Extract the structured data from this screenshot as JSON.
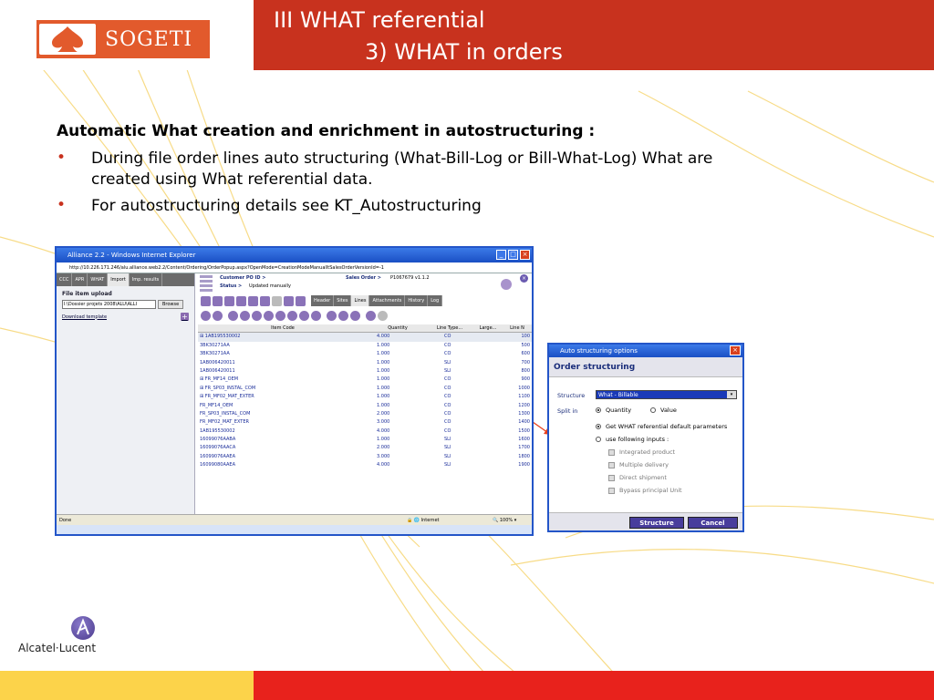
{
  "header": {
    "title_line1": "III WHAT referential",
    "title_line2": "3) WHAT in orders",
    "logo_text": "SOGETI",
    "colors": {
      "accent_red": "#c8321e",
      "logo_orange": "#e25a2c",
      "footer_yellow": "#fcd34a"
    }
  },
  "content": {
    "heading": "Automatic What creation and enrichment in autostructuring :",
    "bullets": [
      {
        "line1": "During file order lines auto structuring (What-Bill-Log or Bill-What-Log) What are",
        "line2": "created using What referential data."
      },
      {
        "line1": "For autostructuring details see KT_Autostructuring"
      }
    ]
  },
  "browser": {
    "title": "Alliance 2.2 - Windows Internet Explorer",
    "address": "http://10.226.171.246/alu.alliance.web2.2/Content/Ordering/OrderPopup.aspx?OpenMode=CreationModeManualItSalesOrderVersionId=-1",
    "left_tabs": [
      "CCC",
      "APR",
      "WHAT",
      "Import",
      "Imp. results"
    ],
    "file_upload_label": "File item upload",
    "file_path": "I:\\Dossier projets 2008\\ALU\\ALLI",
    "browse_label": "Browse",
    "download_template": "Download template",
    "customer_po_label": "Customer PO ID >",
    "status_label": "Status >",
    "status_value": "Updated manually",
    "sales_order_label": "Sales Order >",
    "sales_order_value": "P1067679  v1.1.2",
    "right_tabs": [
      "Header",
      "Sites",
      "Lines",
      "Attachments",
      "History",
      "Log"
    ],
    "grid_headers": [
      "Item Code",
      "Quantity",
      "Line Type...",
      "Large...",
      "Line N"
    ],
    "grid_rows": [
      [
        "⊞ 1AB195530002",
        "4.000",
        "CO",
        "",
        "100"
      ],
      [
        "3BK30271AA",
        "1.000",
        "CO",
        "",
        "500"
      ],
      [
        "3BK30271AA",
        "1.000",
        "CO",
        "",
        "600"
      ],
      [
        "1AB006420011",
        "1.000",
        "SLI",
        "",
        "700"
      ],
      [
        "1AB006420011",
        "1.000",
        "SLI",
        "",
        "800"
      ],
      [
        "⊞ FR_MF14_OEM",
        "1.000",
        "CO",
        "",
        "900"
      ],
      [
        "⊞ FR_SP03_INSTAL_COM",
        "1.000",
        "CO",
        "",
        "1000"
      ],
      [
        "⊞ FR_MF02_MAT_EXTER",
        "1.000",
        "CO",
        "",
        "1100"
      ],
      [
        "FR_MF14_OEM",
        "1.000",
        "CO",
        "",
        "1200"
      ],
      [
        "FR_SP03_INSTAL_COM",
        "2.000",
        "CO",
        "",
        "1300"
      ],
      [
        "FR_MF02_MAT_EXTER",
        "3.000",
        "CO",
        "",
        "1400"
      ],
      [
        "1AB195530002",
        "4.000",
        "CO",
        "",
        "1500"
      ],
      [
        "16099076AABA",
        "1.000",
        "SLI",
        "",
        "1600"
      ],
      [
        "16099076AACA",
        "2.000",
        "SLI",
        "",
        "1700"
      ],
      [
        "16099076AAEA",
        "3.000",
        "SLI",
        "",
        "1800"
      ],
      [
        "16099080AAEA",
        "4.000",
        "SLI",
        "",
        "1900"
      ]
    ],
    "status_bar": "Done",
    "zone": "Internet",
    "zoom": "100%"
  },
  "dialog": {
    "title": "Auto structuring options",
    "heading": "Order structuring",
    "structure_label": "Structure",
    "structure_value": "What - Billable",
    "split_label": "Split in",
    "split_quantity": "Quantity",
    "split_value": "Value",
    "opt_default": "Get WHAT referential default parameters",
    "opt_following": "use following inputs :",
    "checks": [
      "Integrated product",
      "Multiple delivery",
      "Direct shipment",
      "Bypass principal Unit"
    ],
    "btn_structure": "Structure",
    "btn_cancel": "Cancel"
  },
  "footer": {
    "brand": "Alcatel·Lucent"
  }
}
